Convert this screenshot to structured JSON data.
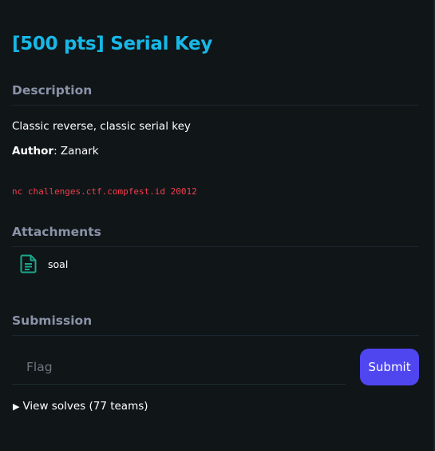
{
  "challenge": {
    "title": "[500 pts] Serial Key"
  },
  "description": {
    "heading": "Description",
    "text": "Classic reverse, classic serial key",
    "author_label": "Author",
    "author_sep": ": ",
    "author_name": "Zanark",
    "command": "nc challenges.ctf.compfest.id 20012"
  },
  "attachments": {
    "heading": "Attachments",
    "items": [
      {
        "icon": "file-document-icon",
        "name": "soal"
      }
    ]
  },
  "submission": {
    "heading": "Submission",
    "flag_placeholder": "Flag",
    "flag_value": "",
    "submit_label": "Submit"
  },
  "solves": {
    "arrow": "▶",
    "label": "View solves (77 teams)"
  },
  "colors": {
    "background": "#101518",
    "title": "#17b8e6",
    "section_heading": "#8b93a8",
    "command": "#f23f4d",
    "accent_button": "#4f46f0",
    "attachment_icon": "#1aa88a"
  }
}
